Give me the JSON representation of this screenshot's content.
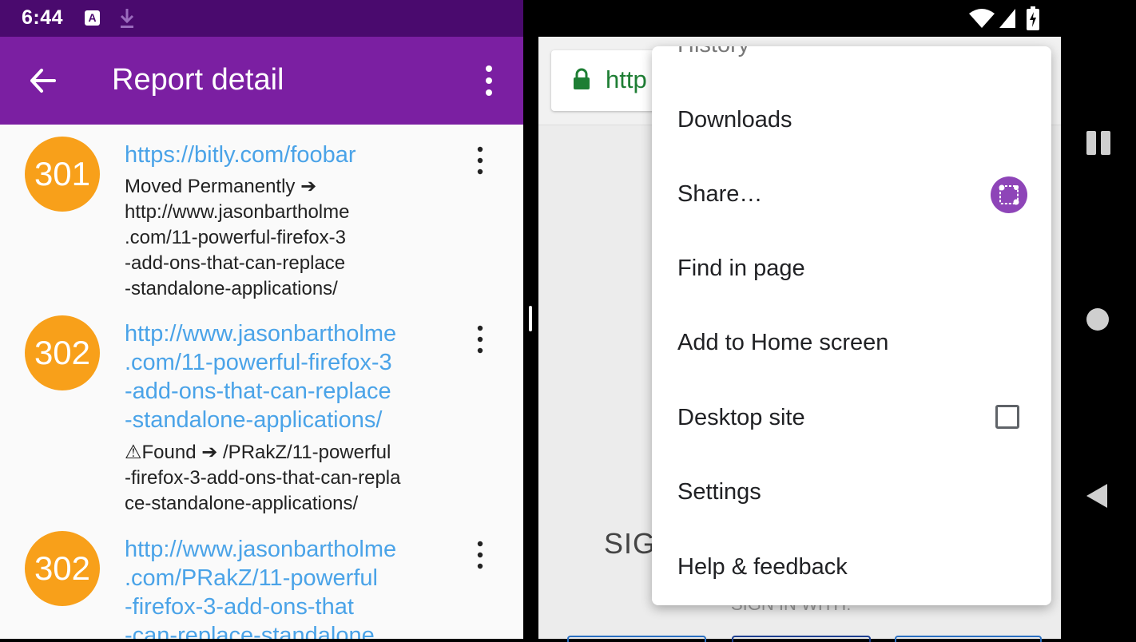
{
  "status_bar": {
    "time": "6:44",
    "keyboard_badge": "A"
  },
  "app_bar": {
    "title": "Report detail"
  },
  "reports": [
    {
      "code": "301",
      "url_lines": [
        "https://bitly.com/foobar"
      ],
      "message_lines": [
        "Moved Permanently ➔",
        "http://www.jasonbartholme",
        ".com/11-powerful-firefox-3",
        "-add-ons-that-can-replace",
        "-standalone-applications/"
      ]
    },
    {
      "code": "302",
      "url_lines": [
        "http://www.jasonbartholme",
        ".com/11-powerful-firefox-3",
        "-add-ons-that-can-replace",
        "-standalone-applications/"
      ],
      "message_lines": [
        "⚠Found ➔ /PRakZ/11-powerful",
        "-firefox-3-add-ons-that-can-repla",
        "ce-standalone-applications/"
      ]
    },
    {
      "code": "302",
      "url_lines": [
        "http://www.jasonbartholme",
        ".com/PRakZ/11-powerful",
        "-firefox-3-add-ons-that",
        "-can-replace-standalone"
      ],
      "message_lines": []
    }
  ],
  "browser": {
    "url_visible": "http",
    "partial_heading": "SIG",
    "partial_sign_in": "SIGN IN WITH:"
  },
  "overflow_menu": {
    "items": [
      "History",
      "Downloads",
      "Share…",
      "Find in page",
      "Add to Home screen",
      "Desktop site",
      "Settings",
      "Help & feedback"
    ]
  },
  "colors": {
    "status_bar": "#4a0a6e",
    "app_bar": "#7b1fa2",
    "badge": "#f8a01a",
    "link": "#4aa3e8",
    "secure_green": "#1e7e34"
  }
}
